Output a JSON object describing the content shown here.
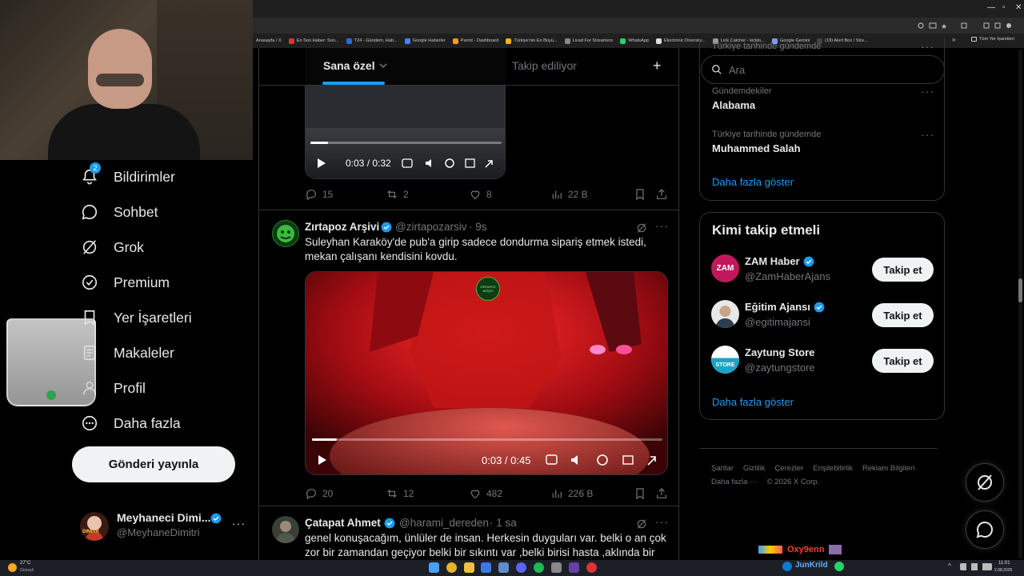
{
  "browser": {
    "bookmarks": [
      "Anasayfa / X",
      "En Son Haber: Son...",
      "T24 - Gündem, Hab...",
      "Google Haberler",
      "Parrot - Dashboard",
      "Türkiye'nin En Büyü...",
      "Livad For Streamers",
      "WhatsApp",
      "Electronic Diversity...",
      "Link Catcher - kicklo...",
      "Google Gemini",
      "(19) Alert Box / Stre..."
    ],
    "bookmarks_more": "»",
    "all_bookmarks": "Tüm Yer İşaretleri"
  },
  "nav": {
    "notifications_badge": "2",
    "items": [
      {
        "label": "Bildirimler",
        "icon": "bell-icon"
      },
      {
        "label": "Sohbet",
        "icon": "chat-bubble-icon"
      },
      {
        "label": "Grok",
        "icon": "grok-icon"
      },
      {
        "label": "Premium",
        "icon": "premium-badge-icon"
      },
      {
        "label": "Yer İşaretleri",
        "icon": "bookmark-icon"
      },
      {
        "label": "Makaleler",
        "icon": "article-icon"
      },
      {
        "label": "Profil",
        "icon": "person-icon"
      },
      {
        "label": "Daha fazla",
        "icon": "more-circle-icon"
      }
    ],
    "post_button": "Gönderi yayınla",
    "account": {
      "name": "Meyhaneci Dimi...",
      "handle": "@MeyhaneDimitri",
      "more": "···",
      "avatar_text": "DIMITR"
    }
  },
  "timeline": {
    "tabs": [
      {
        "label": "Sana özel",
        "active": true
      },
      {
        "label": "Takip ediliyor",
        "active": false
      }
    ],
    "add_tab": "+",
    "top_post": {
      "video": {
        "time": "0:03 / 0:32",
        "progress": 0.09
      },
      "stats": {
        "replies": "15",
        "reposts": "2",
        "likes": "8",
        "views": "22 B"
      }
    },
    "post2": {
      "name": "Zırtapoz Arşivi",
      "handle": "@zirtapozarsiv",
      "time": "· 9s",
      "text_line1": "Suleyhan Karaköy'de pub'a girip sadece dondurma sipariş etmek istedi,",
      "text_line2": "mekan çalışanı kendisini kovdu.",
      "video": {
        "time": "0:03 / 0:45",
        "progress": 0.07,
        "watermark": "ZIRTAPOZ ARŞİVİ"
      },
      "stats": {
        "replies": "20",
        "reposts": "12",
        "likes": "482",
        "views": "226 B"
      }
    },
    "post3": {
      "name": "Çatapat Ahmet",
      "handle": "@harami_dereden",
      "time": "· 1 sa",
      "text_line1": "genel konuşacağım, ünlüler de insan. Herkesin duyguları var.  belki o an çok",
      "text_line2": "zor bir zamandan geçiyor belki bir sıkıntı var ,belki birisi hasta ,aklında bir"
    }
  },
  "right": {
    "search_placeholder": "Ara",
    "trends_cut_label": "Türkiye tarihinde gündemde",
    "trends": [
      {
        "context": "Gündemdekiler",
        "name": "Alabama"
      },
      {
        "context": "Türkiye tarihinde gündemde",
        "name": "Muhammed Salah"
      }
    ],
    "trends_more": "Daha fazla göster",
    "who_to_follow": {
      "title": "Kimi takip etmeli",
      "accounts": [
        {
          "name": "ZAM Haber",
          "handle": "@ZamHaberAjans",
          "avatar": "ZAM",
          "button": "Takip et",
          "color": "#c2185b"
        },
        {
          "name": "Eğitim Ajansı",
          "handle": "@egitimajansi",
          "avatar": "",
          "button": "Takip et",
          "color": "#8a8f95"
        },
        {
          "name": "Zaytung Store",
          "handle": "@zaytungstore",
          "avatar": "STORE",
          "button": "Takip et",
          "color": "#1ba3c6"
        }
      ],
      "more": "Daha fazla göster"
    },
    "footer": {
      "links": [
        "Şartlar",
        "Gizlilik",
        "Çerezler",
        "Erişilebilirlik",
        "Reklam Bilgileri",
        "Daha fazla ···"
      ],
      "copyright": "© 2026 X Corp."
    }
  },
  "stream_overlay": {
    "user1": "Oxy9enn",
    "user2": "JunKrild"
  },
  "taskbar": {
    "weather_temp": "27°C",
    "weather_desc": "Güneşli",
    "time": "11:01",
    "date": "2.08.2026"
  }
}
